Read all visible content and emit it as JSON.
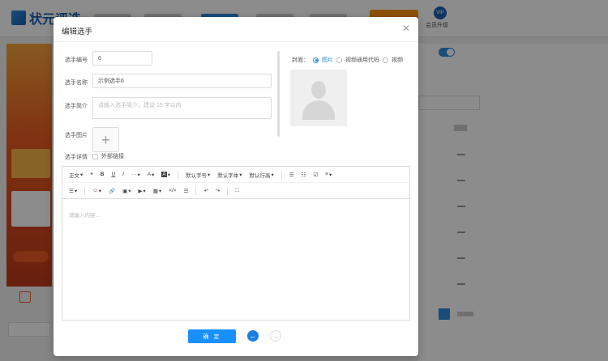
{
  "background": {
    "logo_text": "状元评选",
    "vip_label": "会员升级",
    "vip_badge": "VIP"
  },
  "modal": {
    "title": "编辑选手",
    "close_icon": "close-icon",
    "fields": {
      "number_label": "选手编号",
      "number_value": "6",
      "name_label": "选手名称",
      "name_value": "示例选手6",
      "intro_label": "选手简介",
      "intro_placeholder": "请输入选手简介，建议 15 字以内",
      "image_label": "选手图片",
      "detail_label": "选手详情",
      "external_link_label": "外部链接"
    },
    "cover": {
      "label": "封面：",
      "options": [
        "图片",
        "视频通用代码",
        "视频"
      ],
      "selected": "图片"
    },
    "editor": {
      "toolbar_row1": [
        "正文",
        "❝",
        "B",
        "U",
        "I",
        "···",
        "A",
        "A",
        "默认字号",
        "默认字体",
        "默认行高",
        "☰",
        "☷",
        "☑",
        "≡"
      ],
      "toolbar_row2": [
        "☰",
        "☺",
        "🔗",
        "▣",
        "▶",
        "▦",
        "</>",
        "☰",
        "↶",
        "↷",
        "⛶"
      ],
      "placeholder": "请输入内容..."
    },
    "confirm_label": "确 定"
  },
  "colors": {
    "primary": "#1890ff",
    "accent_orange": "#ff9800"
  }
}
